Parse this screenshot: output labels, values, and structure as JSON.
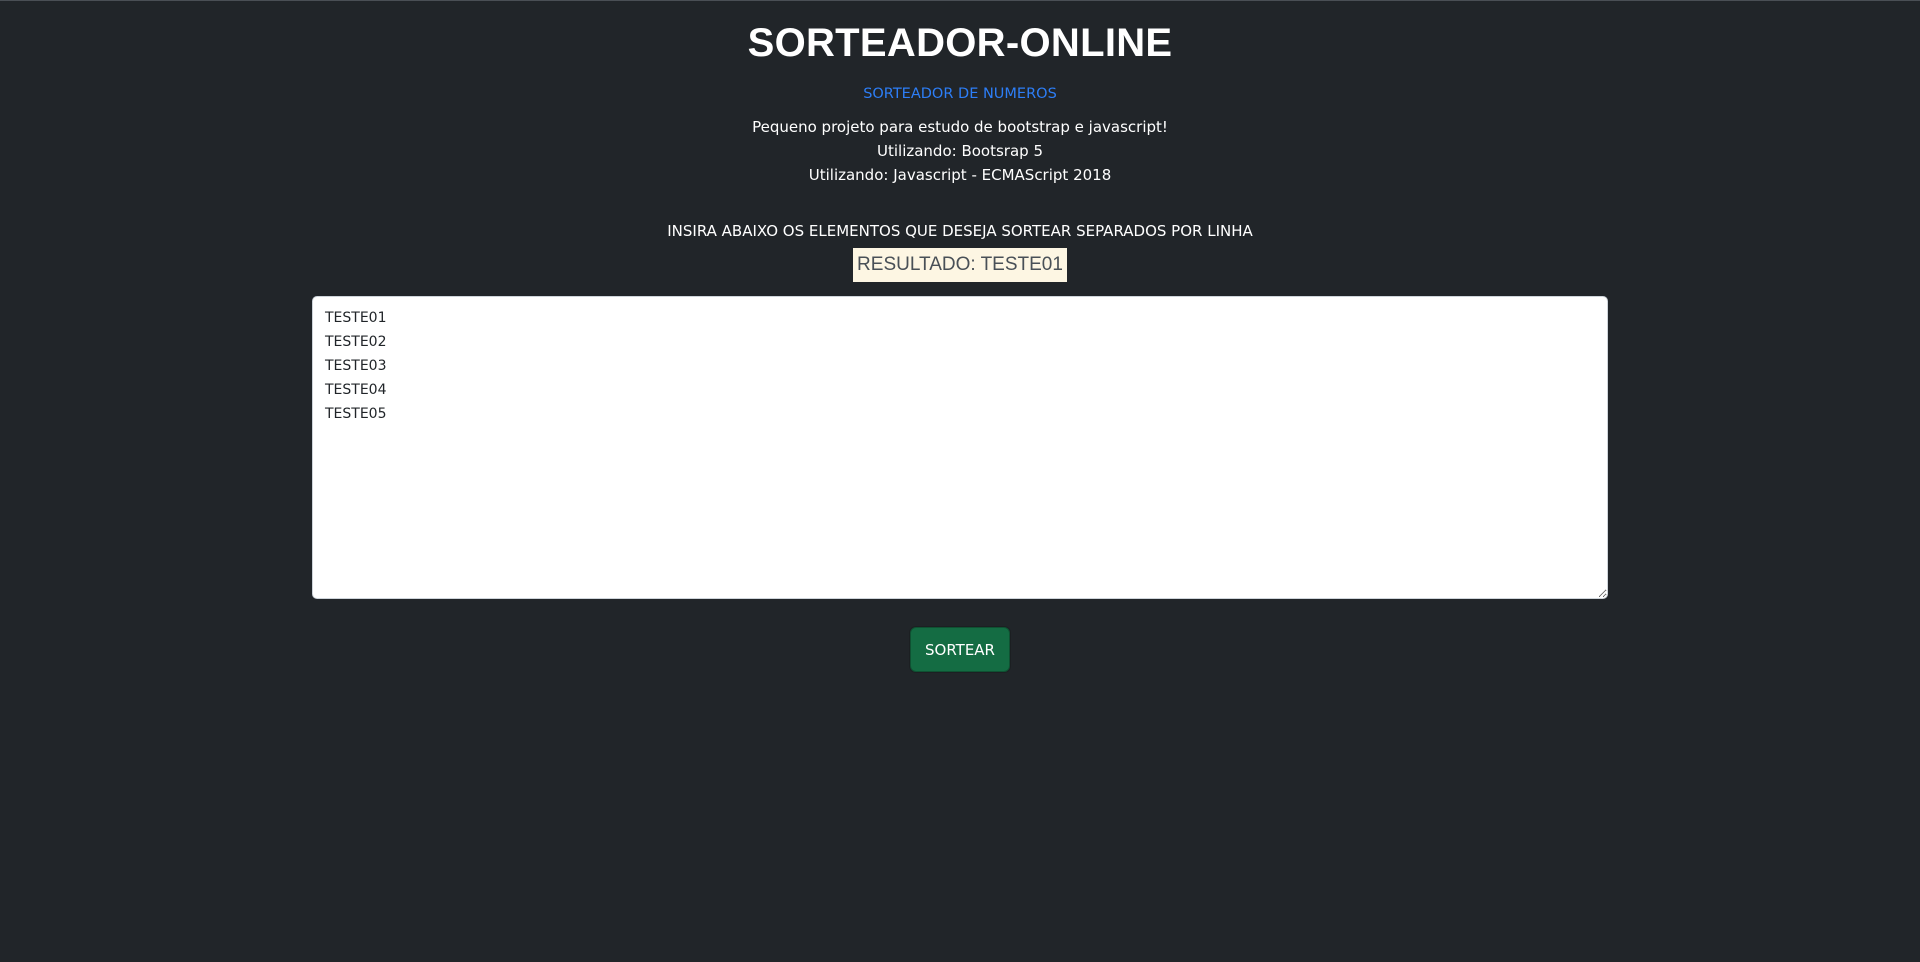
{
  "header": {
    "title": "SORTEADOR-ONLINE",
    "subtitle_link": "SORTEADOR DE NUMEROS"
  },
  "description": {
    "line1": "Pequeno projeto para estudo de bootstrap e javascript!",
    "line2": "Utilizando: Bootsrap 5",
    "line3": "Utilizando: Javascript - ECMAScript 2018"
  },
  "form": {
    "instructions": "INSIRA ABAIXO OS ELEMENTOS QUE DESEJA SORTEAR SEPARADOS POR LINHA",
    "result_text": "RESULTADO: TESTE01",
    "entries_value": "TESTE01\nTESTE02\nTESTE03\nTESTE04\nTESTE05",
    "draw_button_label": "SORTEAR"
  },
  "colors": {
    "background": "#212529",
    "link": "#2d7ef7",
    "result_background": "#fdf6e3",
    "button": "#146c43"
  }
}
